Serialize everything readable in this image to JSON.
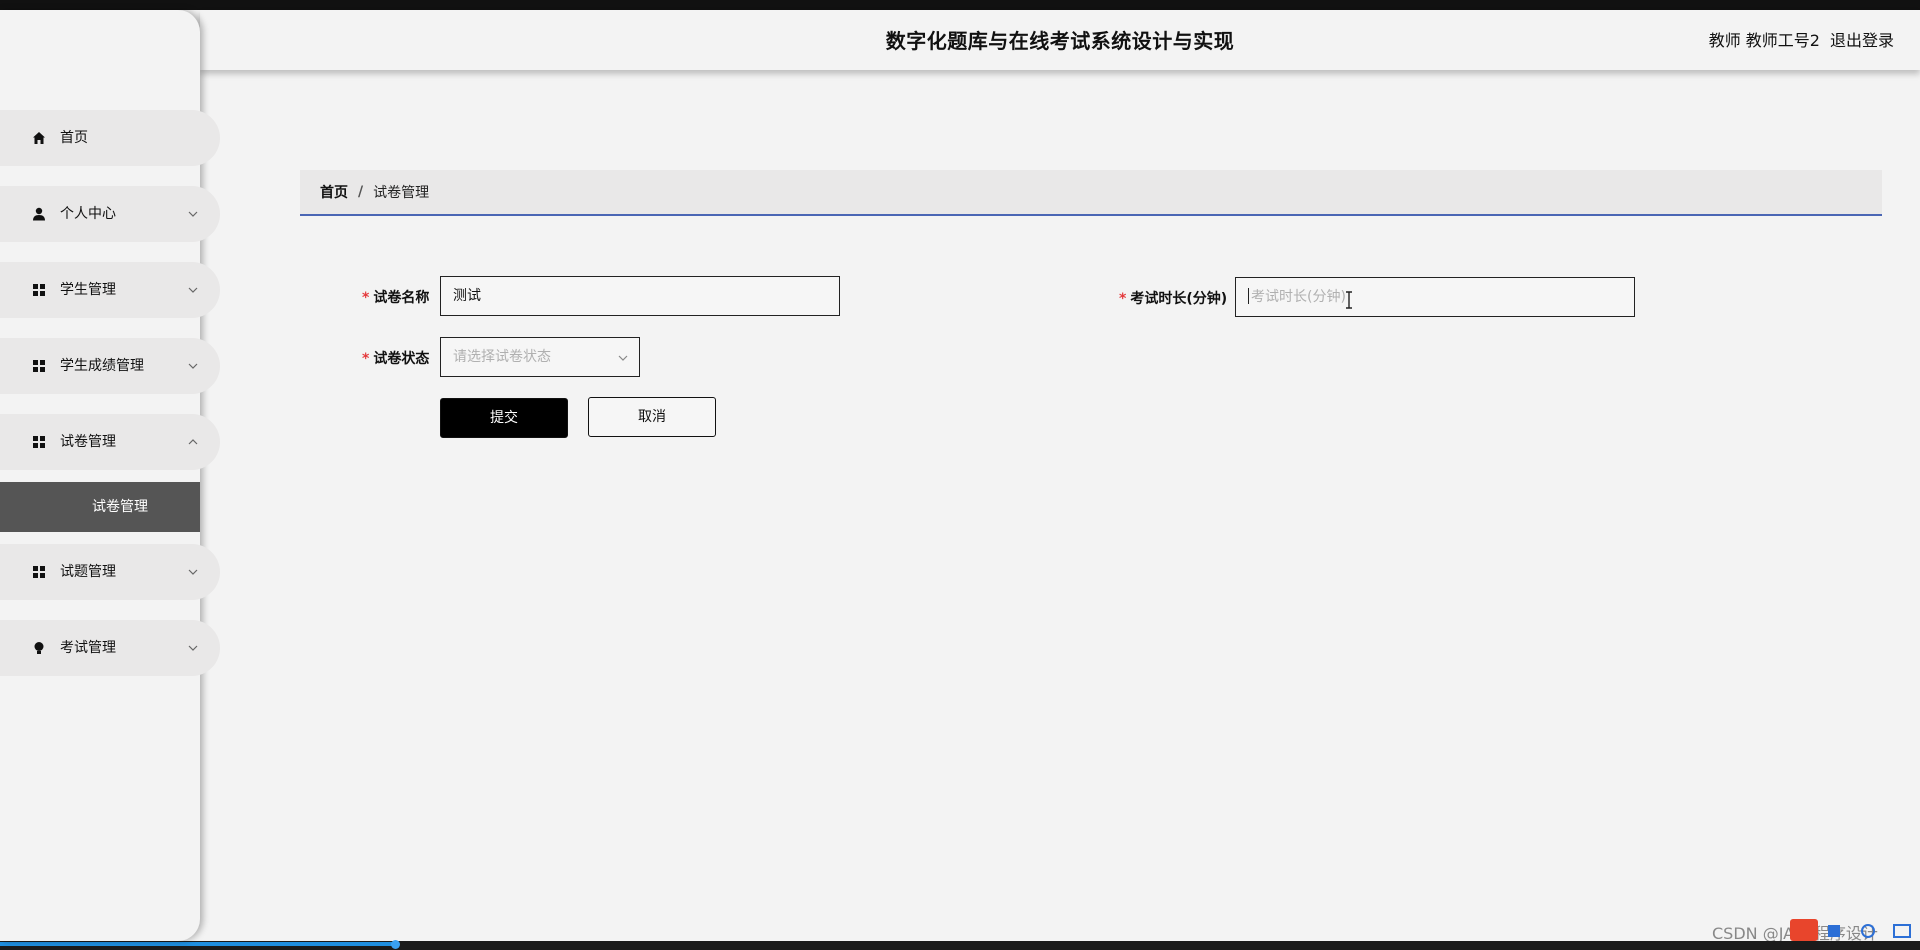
{
  "header": {
    "title": "数字化题库与在线考试系统设计与实现",
    "user": "教师 教师工号2",
    "logout": "退出登录"
  },
  "sidebar": {
    "items": [
      {
        "label": "首页",
        "icon": "home-icon"
      },
      {
        "label": "个人中心",
        "icon": "user-icon"
      },
      {
        "label": "学生管理",
        "icon": "grid-icon"
      },
      {
        "label": "学生成绩管理",
        "icon": "grid-icon"
      },
      {
        "label": "试卷管理",
        "icon": "grid-icon",
        "expanded": true,
        "children": [
          "试卷管理"
        ]
      },
      {
        "label": "试题管理",
        "icon": "grid-icon"
      },
      {
        "label": "考试管理",
        "icon": "bulb-icon"
      }
    ]
  },
  "breadcrumb": {
    "home": "首页",
    "separator": "/",
    "current": "试卷管理"
  },
  "form": {
    "name_label": "试卷名称",
    "name_value": "测试",
    "duration_label": "考试时长(分钟)",
    "duration_placeholder": "考试时长(分钟)",
    "status_label": "试卷状态",
    "status_placeholder": "请选择试卷状态",
    "required_mark": "*",
    "submit_label": "提交",
    "cancel_label": "取消"
  },
  "watermark": "CSDN @JAVA程序设计",
  "colors": {
    "accent_line": "#4a66b4",
    "required": "#e4393c",
    "active_menu_bg": "#555555"
  }
}
